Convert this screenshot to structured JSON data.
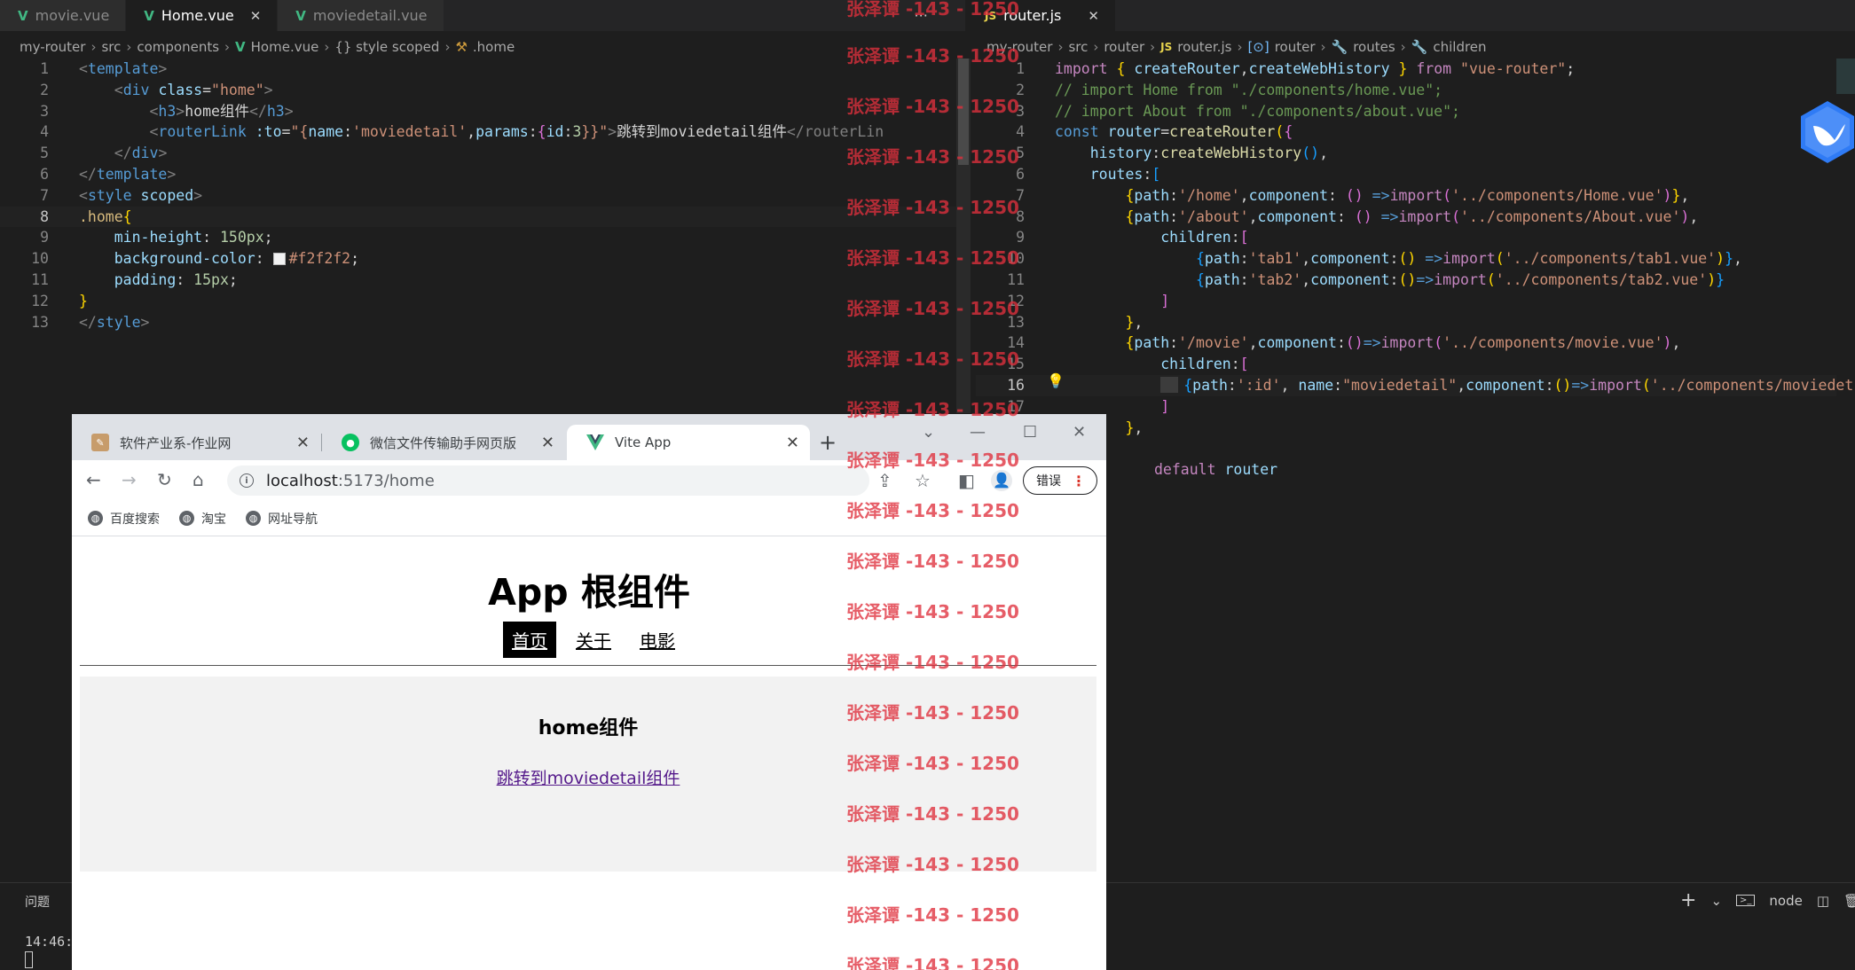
{
  "editor_left": {
    "tabs": [
      {
        "label": "movie.vue",
        "active": false
      },
      {
        "label": "Home.vue",
        "active": true
      },
      {
        "label": "moviedetail.vue",
        "active": false
      }
    ],
    "tabs_overflow": "···",
    "breadcrumb": [
      "my-router",
      "src",
      "components",
      "Home.vue",
      "{} style scoped",
      ".home"
    ],
    "lines": [
      {
        "n": "1"
      },
      {
        "n": "2"
      },
      {
        "n": "3"
      },
      {
        "n": "4"
      },
      {
        "n": "5"
      },
      {
        "n": "6"
      },
      {
        "n": "7"
      },
      {
        "n": "8"
      },
      {
        "n": "9"
      },
      {
        "n": "10"
      },
      {
        "n": "11"
      },
      {
        "n": "12"
      },
      {
        "n": "13"
      }
    ],
    "code": {
      "l1_tag": "template",
      "l2_tag": "div",
      "l2_attr": "class",
      "l2_val": "\"home\"",
      "l3_tag": "h3",
      "l3_text": "home组件",
      "l4_tag": "routerLink",
      "l4_attr": ":to",
      "l4_open": "\"{",
      "l4_name_key": "name",
      "l4_name_val": "'moviedetail'",
      "l4_params_key": "params",
      "l4_id": "id",
      "l4_num": "3",
      "l4_close": "}}\"",
      "l4_text": "跳转到moviedetail组件",
      "l4_end": "</routerLin",
      "l5_tag": "div",
      "l6_tag": "template",
      "l7_tag": "style",
      "l7_attr": "scoped",
      "l8_sel": ".home",
      "l9_prop": "min-height",
      "l9_val": "150px",
      "l10_prop": "background-color",
      "l10_val": "#f2f2f2",
      "l11_prop": "padding",
      "l11_val": "15px",
      "l13_tag": "style"
    }
  },
  "editor_right": {
    "tab": "router.js",
    "breadcrumb": [
      "my-router",
      "src",
      "router",
      "router.js",
      "router",
      "routes",
      "children"
    ],
    "lines": [
      {
        "n": "1"
      },
      {
        "n": "2"
      },
      {
        "n": "3"
      },
      {
        "n": "4"
      },
      {
        "n": "5"
      },
      {
        "n": "6"
      },
      {
        "n": "7"
      },
      {
        "n": "8"
      },
      {
        "n": "9"
      },
      {
        "n": "10"
      },
      {
        "n": "11"
      },
      {
        "n": "12"
      },
      {
        "n": "13"
      },
      {
        "n": "14"
      },
      {
        "n": "15"
      },
      {
        "n": "16"
      },
      {
        "n": "17"
      }
    ],
    "code": {
      "l1": [
        "import",
        " { ",
        "createRouter",
        ",",
        "createWebHistory",
        " } ",
        "from",
        " \"vue-router\"",
        ";"
      ],
      "l2": "// import Home from \"./components/home.vue\";",
      "l3": "// import About from \"./components/about.vue\";",
      "l4": [
        "const",
        " router",
        "=",
        "createRouter",
        "(",
        "{"
      ],
      "l5": [
        "history",
        ":",
        "createWebHistory",
        "()",
        ","
      ],
      "l6": [
        "routes",
        ":",
        "["
      ],
      "l7": [
        "{",
        "path",
        ":",
        "'/home'",
        ",",
        "component",
        ": ",
        "()",
        " =>",
        "import",
        "(",
        "'../components/Home.vue'",
        ")",
        "}",
        ","
      ],
      "l8": [
        "{",
        "path",
        ":",
        "'/about'",
        ",",
        "component",
        ": ",
        "()",
        " =>",
        "import",
        "(",
        "'../components/About.vue'",
        ")",
        ","
      ],
      "l9": [
        "children",
        ":",
        "["
      ],
      "l10": [
        "{",
        "path",
        ":",
        "'tab1'",
        ",",
        "component",
        ":",
        "()",
        " =>",
        "import",
        "(",
        "'../components/tab1.vue'",
        ")",
        "}",
        ","
      ],
      "l11": [
        "{",
        "path",
        ":",
        "'tab2'",
        ",",
        "component",
        ":",
        "()",
        "=>",
        "import",
        "(",
        "'../components/tab2.vue'",
        ")",
        "}"
      ],
      "l12": "]",
      "l13": [
        "}",
        ","
      ],
      "l14": [
        "{",
        "path",
        ":",
        "'/movie'",
        ",",
        "component",
        ":",
        "()",
        "=>",
        "import",
        "(",
        "'../components/movie.vue'",
        ")",
        ","
      ],
      "l15": [
        "children",
        ":",
        "["
      ],
      "l16": [
        "{",
        "path",
        ":",
        "':id'",
        ", ",
        "name",
        ":",
        "\"moviedetail\"",
        ",",
        "component",
        ":",
        "()",
        "=>",
        "import",
        "(",
        "'../components/moviedet"
      ],
      "l17": "]",
      "l18": [
        "}",
        ","
      ],
      "l20": [
        "default",
        " router"
      ]
    }
  },
  "panel": {
    "title": "问题",
    "time": "14:46:",
    "node_label": "node",
    "plus": "+",
    "chevron": "⌄"
  },
  "browser": {
    "tabs": [
      {
        "label": "软件产业系-作业网"
      },
      {
        "label": "微信文件传输助手网页版"
      },
      {
        "label": "Vite App"
      }
    ],
    "new_tab": "+",
    "url_host": "localhost",
    "url_rest": ":5173/home",
    "error_button": "错误",
    "bookmarks": [
      "百度搜索",
      "淘宝",
      "网址导航"
    ],
    "page": {
      "title": "App 根组件",
      "nav": [
        {
          "label": "首页",
          "active": true
        },
        {
          "label": "关于",
          "active": false
        },
        {
          "label": "电影",
          "active": false
        }
      ],
      "home_heading": "home组件",
      "link": "跳转到moviedetail组件"
    }
  },
  "watermark": "张泽谭 -143 - 1250"
}
